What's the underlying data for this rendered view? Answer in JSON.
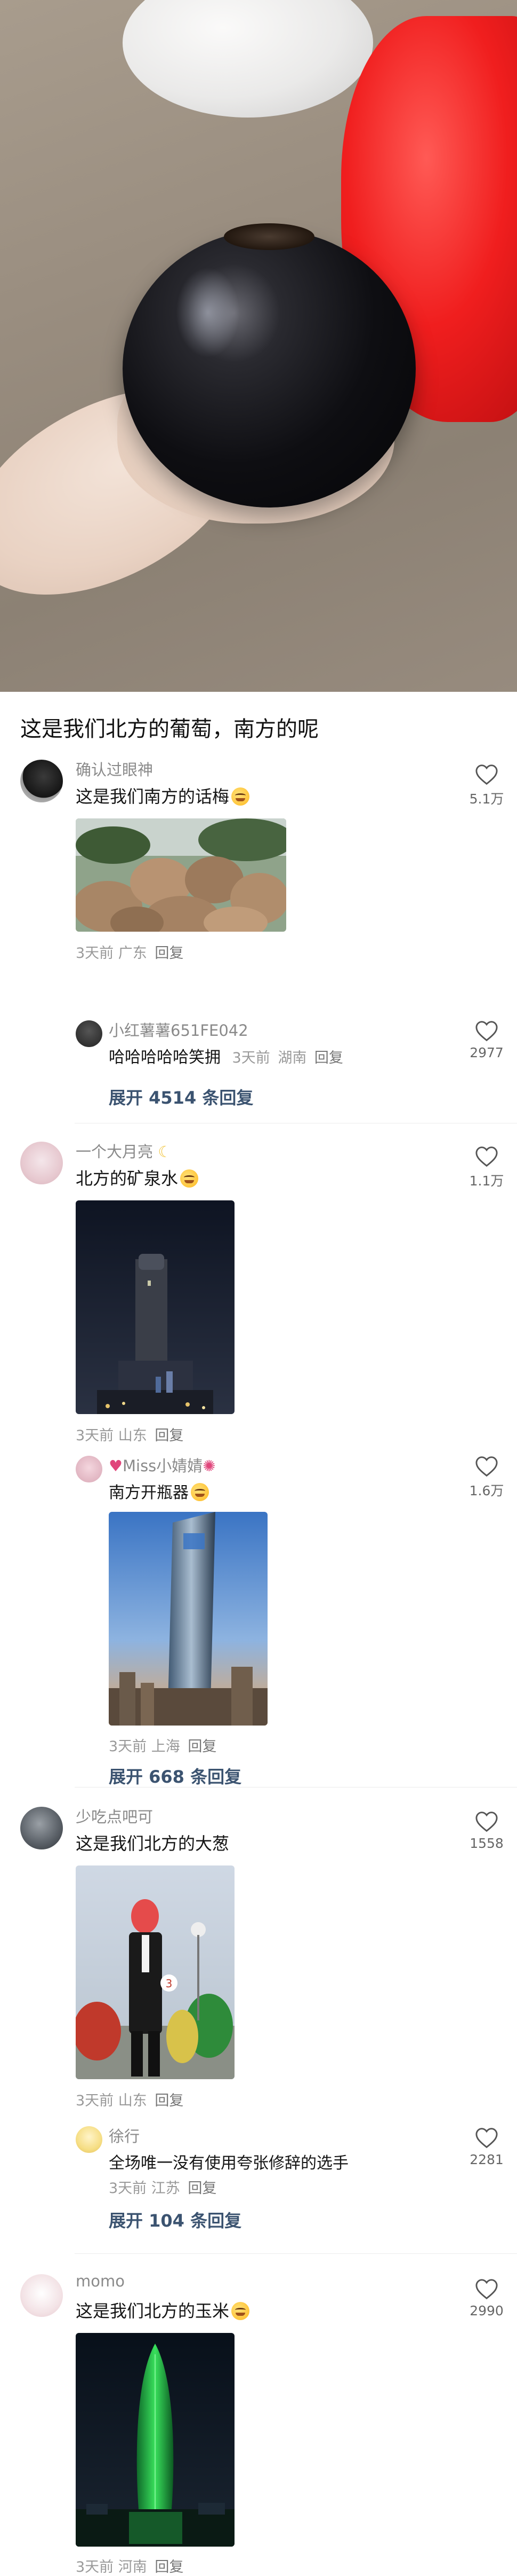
{
  "post": {
    "title": "这是我们北方的葡萄，南方的呢"
  },
  "comments": [
    {
      "user": "确认过眼神",
      "text": "这是我们南方的话梅",
      "time": "3天前",
      "location": "广东",
      "reply_label": "回复",
      "likes": "5.1万",
      "replies": [
        {
          "user": "小红薯薯651FE042",
          "text": "哈哈哈哈哈笑拥",
          "time": "3天前",
          "location": "湖南",
          "reply_label": "回复",
          "likes": "2977"
        }
      ],
      "expand_label": "展开 4514 条回复"
    },
    {
      "user": "一个大月亮",
      "text": "北方的矿泉水",
      "time": "3天前",
      "location": "山东",
      "reply_label": "回复",
      "likes": "1.1万",
      "replies": [
        {
          "user": "Miss小婧婧",
          "text": "南方开瓶器",
          "time": "3天前",
          "location": "上海",
          "reply_label": "回复",
          "likes": "1.6万"
        }
      ],
      "expand_label": "展开 668 条回复"
    },
    {
      "user": "少吃点吧可",
      "text": "这是我们北方的大葱",
      "time": "3天前",
      "location": "山东",
      "reply_label": "回复",
      "likes": "1558",
      "replies": [
        {
          "user": "徐行",
          "text": "全场唯一没有使用夸张修辞的选手",
          "time": "3天前",
          "location": "江苏",
          "reply_label": "回复",
          "likes": "2281"
        }
      ],
      "expand_label": "展开 104 条回复"
    },
    {
      "user": "momo",
      "text": "这是我们北方的玉米",
      "time": "3天前",
      "location": "河南",
      "reply_label": "回复",
      "likes": "2990"
    }
  ],
  "icons": {
    "like": "heart-outline-icon",
    "emoji": "grinning-face-emoji"
  },
  "colors": {
    "expand_link": "#3b5370",
    "meta": "#999999"
  }
}
